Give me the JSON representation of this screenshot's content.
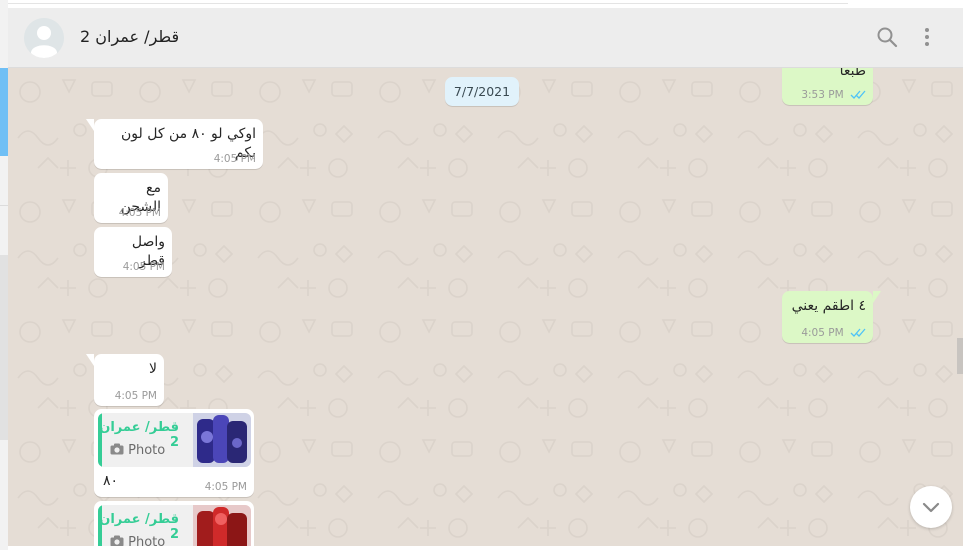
{
  "header": {
    "contact_name": "قطر/ عمران 2",
    "icons": [
      "default-avatar-icon",
      "search-icon",
      "menu-dots-icon"
    ]
  },
  "date_separator": "7/7/2021",
  "messages": [
    {
      "direction": "outgoing",
      "text": "طبعا",
      "time": "3:53 PM",
      "status": "read"
    },
    {
      "direction": "incoming",
      "text": "اوكي لو ٨٠ من كل لون بكم",
      "time": "4:05 PM"
    },
    {
      "direction": "incoming",
      "text": "مع الشحن",
      "time": "4:05 PM"
    },
    {
      "direction": "incoming",
      "text": "واصل قطر",
      "time": "4:05 PM"
    },
    {
      "direction": "outgoing",
      "text": "٤ اطقم يعني",
      "time": "4:05 PM",
      "status": "read"
    },
    {
      "direction": "incoming",
      "text": "لا",
      "time": "4:05 PM"
    },
    {
      "direction": "incoming",
      "quote": {
        "name": "قطر/ عمران 2",
        "kind": "Photo"
      },
      "text": "٨٠",
      "time": "4:05 PM"
    },
    {
      "direction": "incoming",
      "quote": {
        "name": "قطر/ عمران 2",
        "kind": "Photo"
      },
      "text": "",
      "time": ""
    }
  ],
  "colors": {
    "chat_background": "#e5ddd5",
    "incoming_bubble": "#ffffff",
    "outgoing_bubble": "#dcf8c6",
    "quote_accent": "#35cd96",
    "read_ticks": "#4fc3f7"
  }
}
